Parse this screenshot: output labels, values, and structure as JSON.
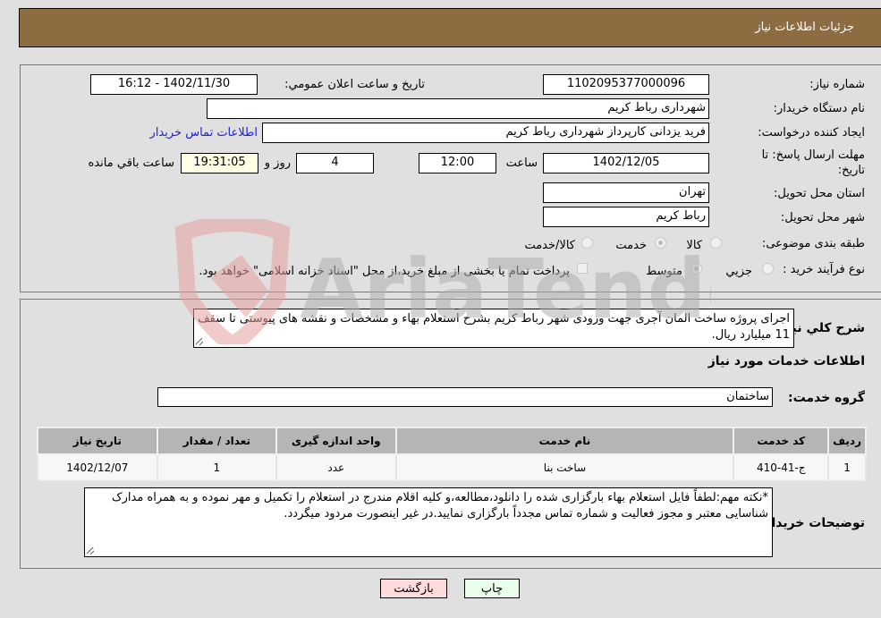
{
  "header": {
    "title": "جزئیات اطلاعات نیاز"
  },
  "form": {
    "need_number_label": "شماره نیاز:",
    "need_number": "1102095377000096",
    "announce_label": "تاریخ و ساعت اعلان عمومي:",
    "announce_value": "1402/11/30 - 16:12",
    "buyer_org_label": "نام دستگاه خریدار:",
    "buyer_org": "شهرداری رباط کریم",
    "creator_label": "ایجاد کننده درخواست:",
    "creator": "فرید یزدانی کارپرداز شهرداری رباط کریم",
    "buyer_contact_link": "اطلاعات تماس خریدار",
    "deadline_label_line1": "مهلت ارسال پاسخ: تا",
    "deadline_label_line2": "تاریخ:",
    "deadline_date": "1402/12/05",
    "time_label": "ساعت",
    "deadline_time": "12:00",
    "days_value": "4",
    "days_label": "روز و",
    "remaining_time": "19:31:05",
    "remaining_label": "ساعت باقي مانده",
    "province_label": "استان محل تحویل:",
    "province": "تهران",
    "city_label": "شهر محل تحویل:",
    "city": "رباط کریم",
    "category_label": "طبقه بندی موضوعی:",
    "category_options": [
      {
        "label": "کالا",
        "checked": false
      },
      {
        "label": "خدمت",
        "checked": true
      },
      {
        "label": "کالا/خدمت",
        "checked": false
      }
    ],
    "process_label": "نوع فرآیند خرید :",
    "process_options": [
      {
        "label": "جزيي",
        "checked": false
      },
      {
        "label": "متوسط",
        "checked": true
      }
    ],
    "treasury_checkbox_label": "پرداخت تمام یا بخشی از مبلغ خرید،از محل \"اسناد خزانه اسلامی\" خواهد بود.",
    "treasury_checked": false
  },
  "details": {
    "description_label": "شرح کلي نیاز:",
    "description": "اجرای پروژه ساخت المان آجری جهت ورودی شهر رباط کریم بشرح استعلام بهاء و مشخصات و نقشه های پیوستی تا سقف 11 میلیارد ریال.",
    "services_title": "اطلاعات خدمات مورد نیاز",
    "service_group_label": "گروه خدمت:",
    "service_group": "ساختمان",
    "table": {
      "headers": [
        "ردیف",
        "کد خدمت",
        "نام خدمت",
        "واحد اندازه گیری",
        "تعداد / مقدار",
        "تاریخ نیاز"
      ],
      "rows": [
        [
          "1",
          "ج-41-410",
          "ساخت بنا",
          "عدد",
          "1",
          "1402/12/07"
        ]
      ]
    },
    "buyer_notes_label": "توضیحات خریدار:",
    "buyer_notes": "*نکته مهم:لطفاً فایل استعلام بهاء بارگزاری شده را دانلود،مطالعه،و کلیه اقلام مندرج در استعلام را تکمیل و مهر نموده و به همراه مدارک شناسایی معتبر و مجوز فعالیت و شماره تماس مجدداً بارگزاری نمایید.در غیر اینصورت مردود میگردد."
  },
  "buttons": {
    "print": "چاپ",
    "back": "بازگشت"
  },
  "watermark": {
    "text": "AriaTender.neT"
  }
}
